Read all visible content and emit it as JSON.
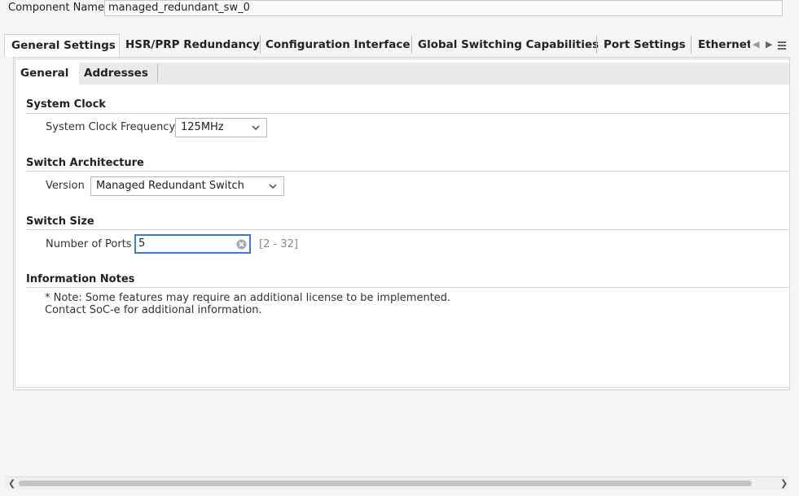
{
  "component": {
    "label": "Component Name",
    "value": "managed_redundant_sw_0"
  },
  "tabs": [
    {
      "label": "General Settings",
      "active": true
    },
    {
      "label": "HSR/PRP Redundancy",
      "active": false
    },
    {
      "label": "Configuration Interface",
      "active": false
    },
    {
      "label": "Global Switching Capabilities",
      "active": false
    },
    {
      "label": "Port Settings",
      "active": false
    },
    {
      "label": "Ethernet",
      "active": false
    }
  ],
  "subtabs": [
    {
      "label": "General",
      "active": true
    },
    {
      "label": "Addresses",
      "active": false
    }
  ],
  "system_clock": {
    "title": "System Clock",
    "frequency_label": "System Clock Frequency",
    "frequency_value": "125MHz"
  },
  "switch_architecture": {
    "title": "Switch Architecture",
    "version_label": "Version",
    "version_value": "Managed Redundant Switch"
  },
  "switch_size": {
    "title": "Switch Size",
    "ports_label": "Number of Ports",
    "ports_value": "5",
    "ports_range": "[2 - 32]"
  },
  "information_notes": {
    "title": "Information Notes",
    "line1": "* Note: Some features may require an additional license to be implemented.",
    "line2": "Contact SoC-e for additional information."
  },
  "icons": {
    "tab_scroll_left": "chevron-left-icon",
    "tab_scroll_right": "chevron-right-icon",
    "tab_menu": "hamburger-menu-icon",
    "dropdown": "chevron-down-icon",
    "clear": "clear-icon"
  },
  "colors": {
    "focus_border": "#3c7bd1"
  }
}
